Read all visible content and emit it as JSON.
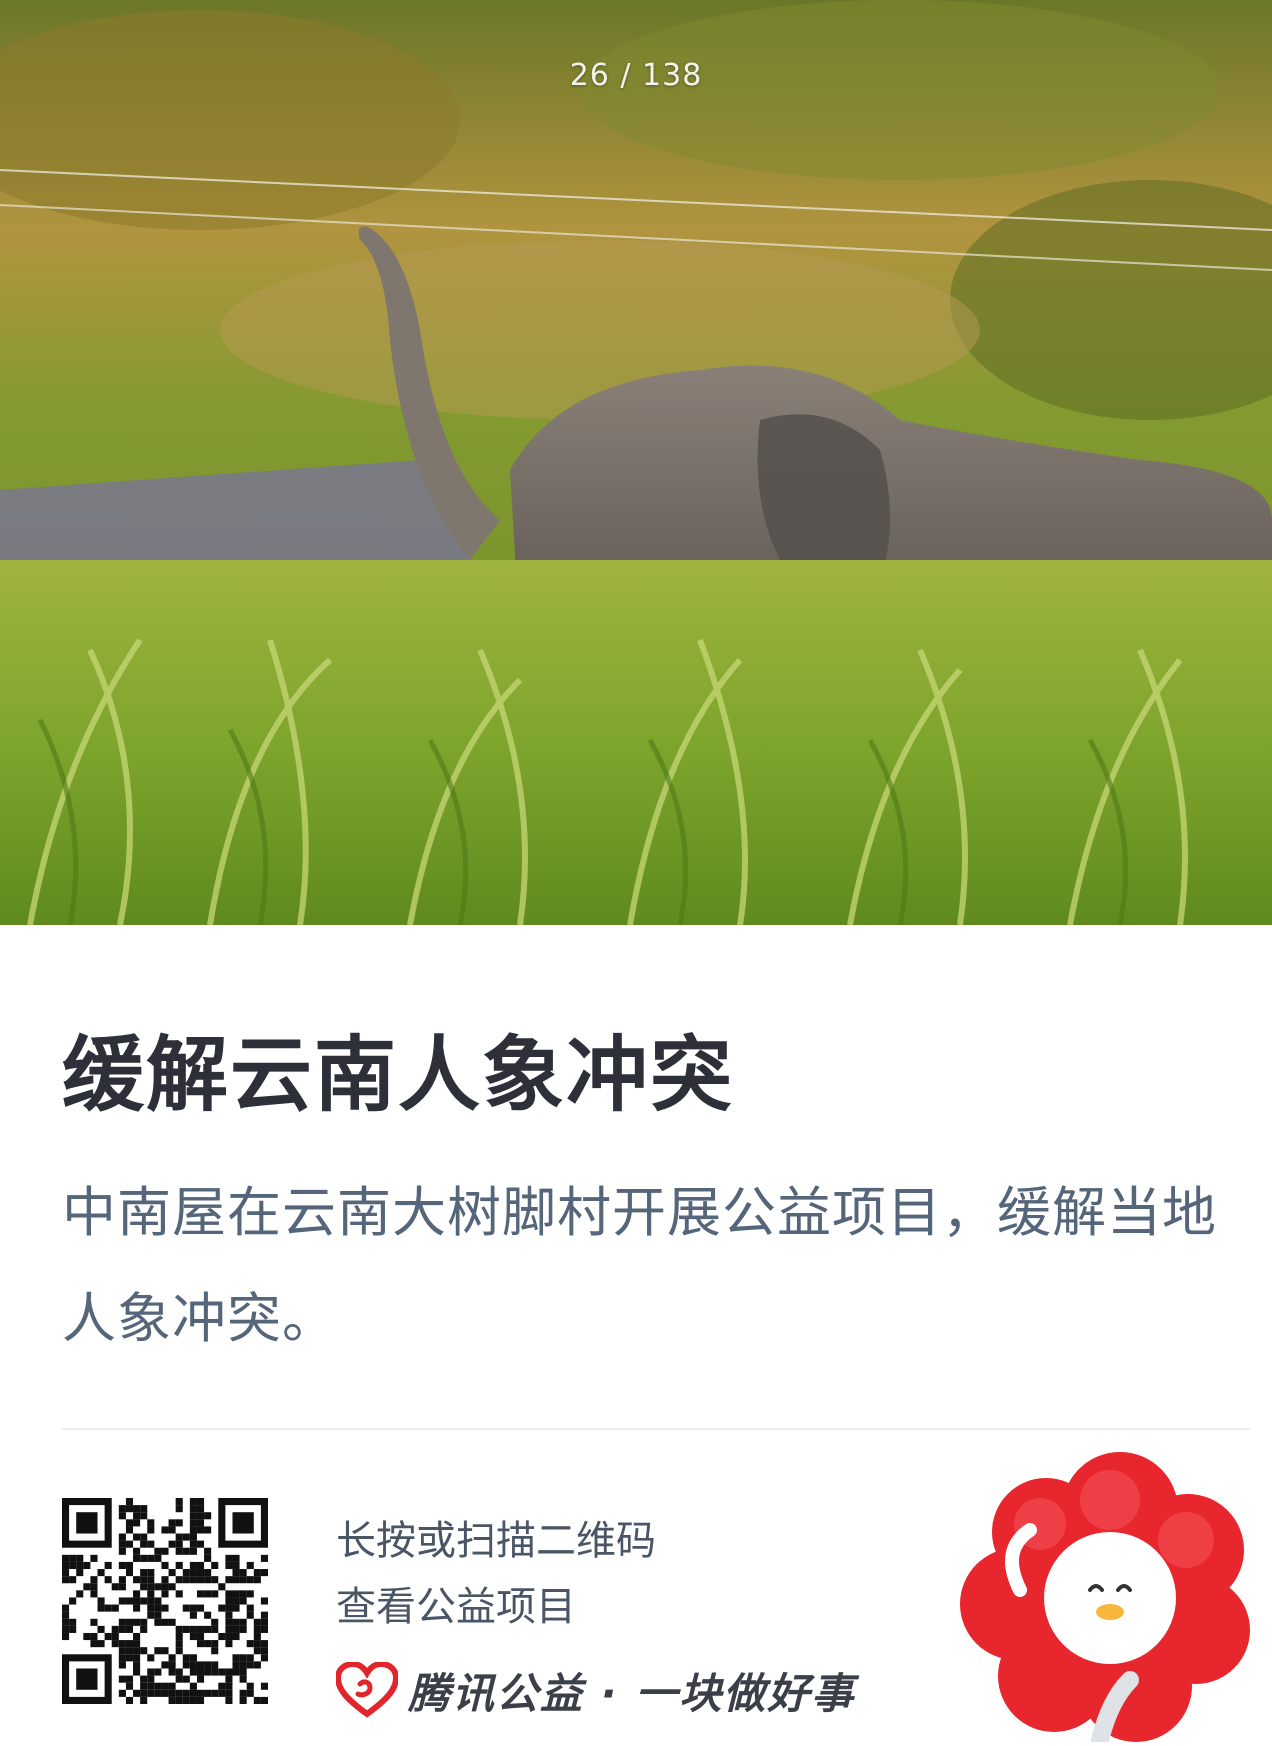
{
  "viewer": {
    "page_counter": "26 / 138"
  },
  "card": {
    "title": "缓解云南人象冲突",
    "description": "中南屋在云南大树脚村开展公益项目，缓解当地人象冲突。"
  },
  "footer": {
    "scan_line1": "长按或扫描二维码",
    "scan_line2": "查看公益项目",
    "brand": "腾讯公益 · 一块做好事"
  },
  "icons": [
    "qr-code-icon",
    "tencent-charity-heart-icon",
    "flower-mascot-icon"
  ],
  "colors": {
    "title": "#2d3038",
    "description": "#55657a",
    "brand_red": "#e0262c"
  }
}
